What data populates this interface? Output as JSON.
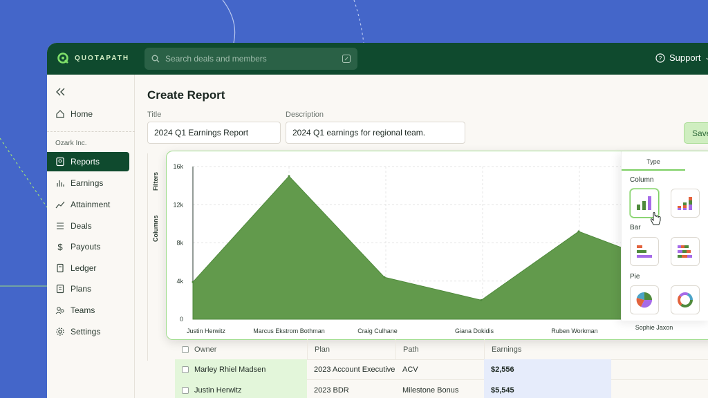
{
  "app": {
    "brand": "QUOTAPATH"
  },
  "search": {
    "placeholder": "Search deals and members"
  },
  "header": {
    "support_label": "Support"
  },
  "sidebar": {
    "org_name": "Ozark Inc.",
    "items": [
      {
        "label": "Home",
        "icon": "home-icon"
      },
      {
        "label": "Reports",
        "icon": "report-icon",
        "active": true
      },
      {
        "label": "Earnings",
        "icon": "earnings-icon"
      },
      {
        "label": "Attainment",
        "icon": "trend-icon"
      },
      {
        "label": "Deals",
        "icon": "list-icon"
      },
      {
        "label": "Payouts",
        "icon": "dollar-icon"
      },
      {
        "label": "Ledger",
        "icon": "ledger-icon"
      },
      {
        "label": "Plans",
        "icon": "plan-icon"
      },
      {
        "label": "Teams",
        "icon": "teams-icon"
      },
      {
        "label": "Settings",
        "icon": "gear-icon"
      }
    ]
  },
  "page": {
    "title": "Create Report",
    "title_label": "Title",
    "title_value": "2024 Q1 Earnings Report",
    "description_label": "Description",
    "description_value": "2024 Q1 earnings for regional team.",
    "save_label": "Save"
  },
  "side_tabs": {
    "filters": "Filters",
    "columns": "Columns"
  },
  "chart_data": {
    "type": "area",
    "categories": [
      "Justin Herwitz",
      "Marcus Ekstrom Bothman",
      "Craig Culhane",
      "Giana Dokidis",
      "Ruben Workman",
      "Sophie Jaxon"
    ],
    "values": [
      3900,
      15000,
      4400,
      2000,
      9200,
      5400
    ],
    "y_ticks": [
      "0",
      "4k",
      "8k",
      "12k",
      "16k"
    ],
    "ylim": [
      0,
      16000
    ],
    "color": "#629a4c",
    "grid": true
  },
  "type_panel": {
    "tab_label": "Type",
    "sections": [
      {
        "label": "Column"
      },
      {
        "label": "Bar"
      },
      {
        "label": "Pie"
      }
    ]
  },
  "table": {
    "headers": [
      "Owner",
      "Plan",
      "Path",
      "Earnings"
    ],
    "rows": [
      [
        "Marley Rhiel Madsen",
        "2023 Account Executive",
        "ACV",
        "$2,556"
      ],
      [
        "Justin Herwitz",
        "2023 BDR",
        "Milestone Bonus",
        "$5,545"
      ]
    ]
  }
}
